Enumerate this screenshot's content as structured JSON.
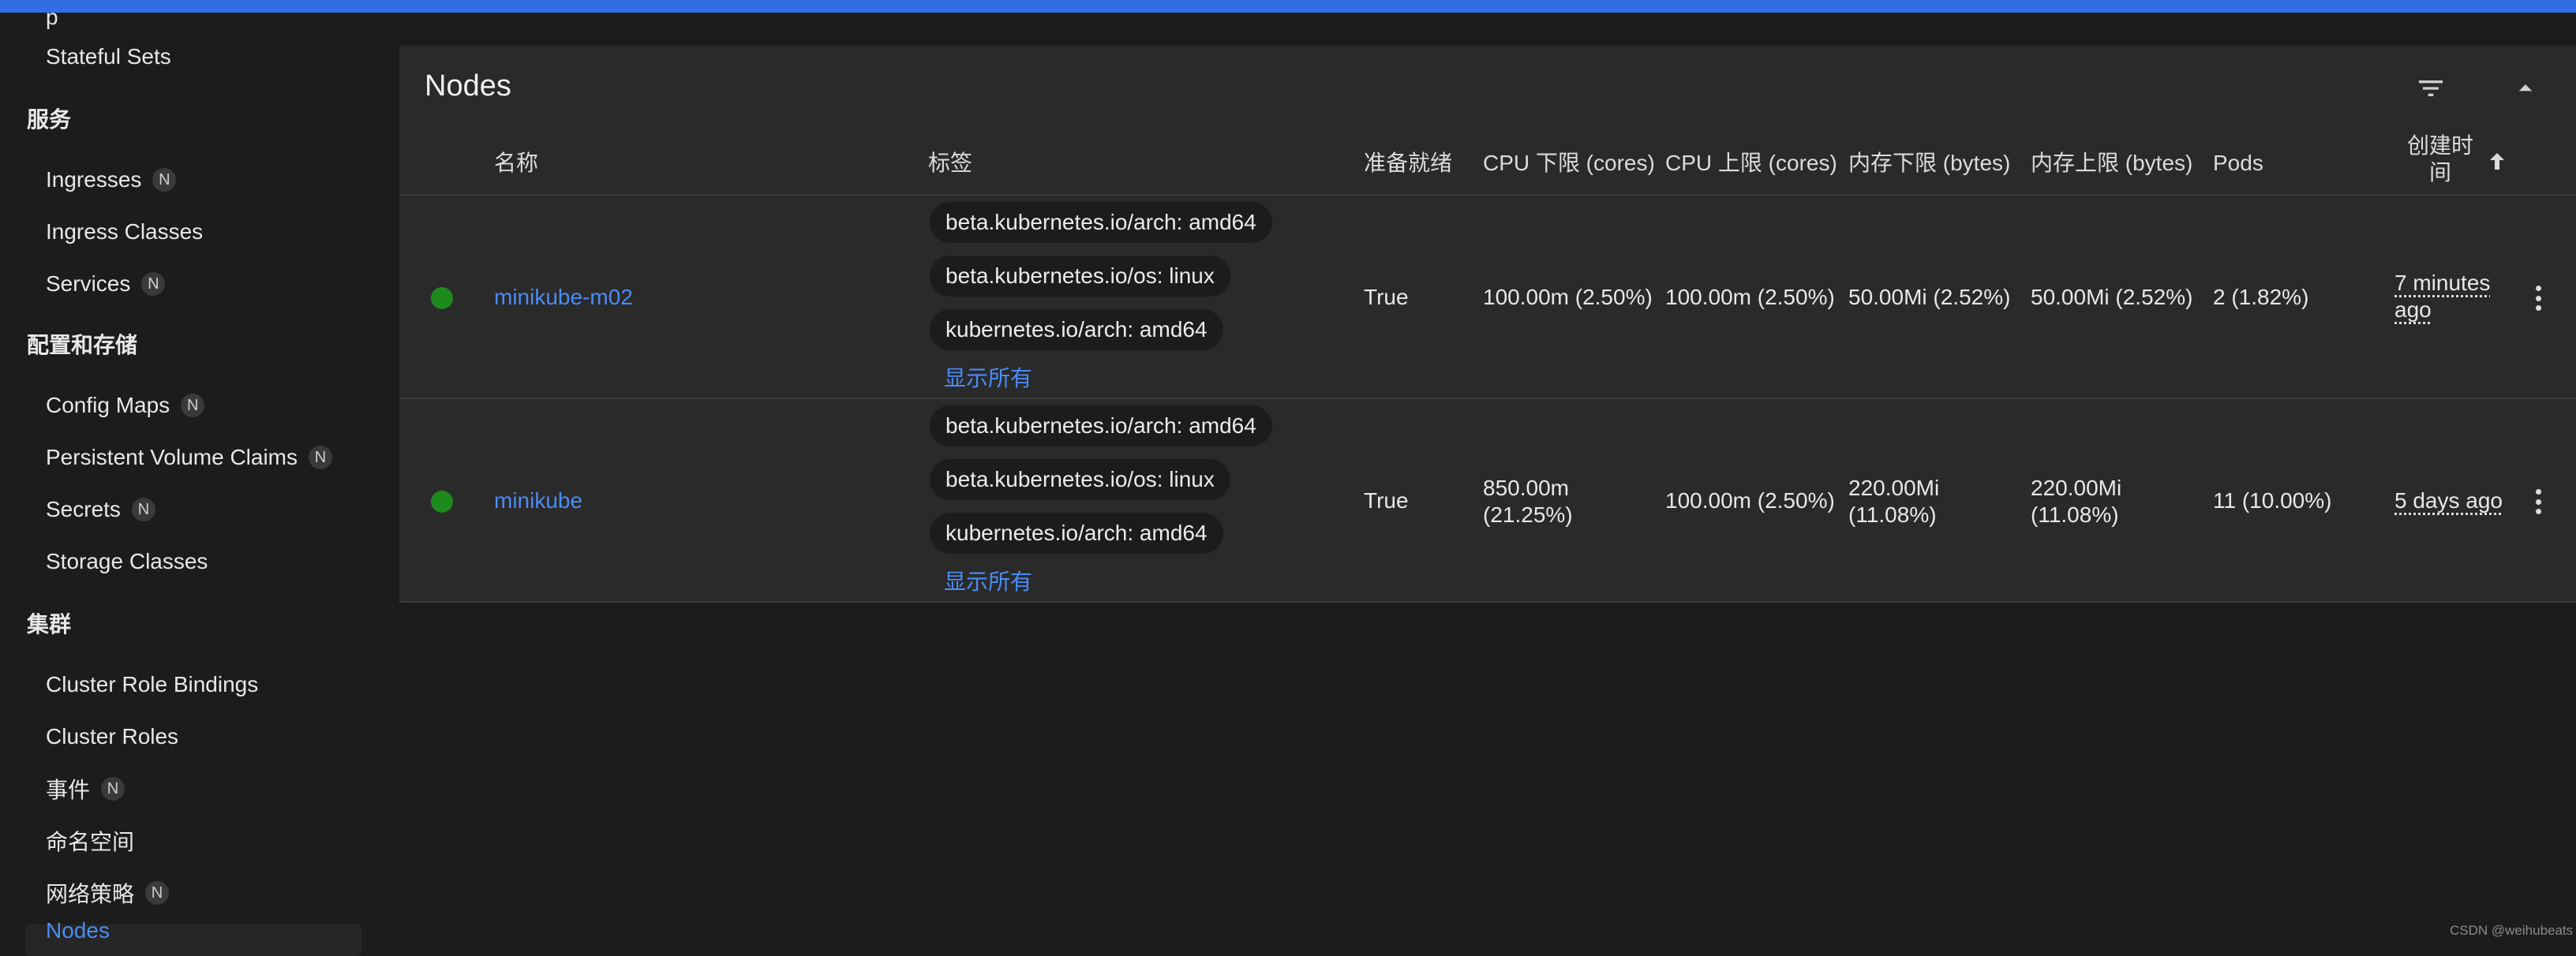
{
  "sidebar": {
    "clipped_item": "p",
    "items": [
      {
        "type": "item",
        "label": "Stateful Sets",
        "badge": ""
      },
      {
        "type": "section",
        "label": "服务"
      },
      {
        "type": "item",
        "label": "Ingresses",
        "badge": "N"
      },
      {
        "type": "item",
        "label": "Ingress Classes",
        "badge": ""
      },
      {
        "type": "item",
        "label": "Services",
        "badge": "N"
      },
      {
        "type": "section",
        "label": "配置和存储"
      },
      {
        "type": "item",
        "label": "Config Maps",
        "badge": "N"
      },
      {
        "type": "item",
        "label": "Persistent Volume Claims",
        "badge": "N"
      },
      {
        "type": "item",
        "label": "Secrets",
        "badge": "N"
      },
      {
        "type": "item",
        "label": "Storage Classes",
        "badge": ""
      },
      {
        "type": "section",
        "label": "集群"
      },
      {
        "type": "item",
        "label": "Cluster Role Bindings",
        "badge": ""
      },
      {
        "type": "item",
        "label": "Cluster Roles",
        "badge": ""
      },
      {
        "type": "item",
        "label": "事件",
        "badge": "N"
      },
      {
        "type": "item",
        "label": "命名空间",
        "badge": ""
      },
      {
        "type": "item",
        "label": "网络策略",
        "badge": "N"
      }
    ],
    "active_item": "Nodes"
  },
  "panel": {
    "title": "Nodes",
    "filter_icon": "filter-list-icon",
    "collapse_icon": "arrow-drop-up-icon"
  },
  "table": {
    "headers": {
      "name": "名称",
      "labels": "标签",
      "ready": "准备就绪",
      "cpu_requests": "CPU 下限 (cores)",
      "cpu_limits": "CPU 上限 (cores)",
      "mem_requests": "内存下限 (bytes)",
      "mem_limits": "内存上限 (bytes)",
      "pods": "Pods",
      "created_line1": "创建时",
      "created_line2": "间",
      "sort_icon": "arrow-upward-icon"
    },
    "rows": [
      {
        "status_color": "#1e8a1e",
        "name": "minikube-m02",
        "labels": [
          "beta.kubernetes.io/arch: amd64",
          "beta.kubernetes.io/os: linux",
          "kubernetes.io/arch: amd64"
        ],
        "show_all": "显示所有",
        "ready": "True",
        "cpu_requests_1": "100.00m (2.50%)",
        "cpu_requests_2": "",
        "cpu_limits": "100.00m (2.50%)",
        "mem_requests_1": "50.00Mi (2.52%)",
        "mem_requests_2": "",
        "mem_limits_1": "50.00Mi (2.52%)",
        "mem_limits_2": "",
        "pods": "2 (1.82%)",
        "created_1": "7 minutes",
        "created_2": "ago"
      },
      {
        "status_color": "#1e8a1e",
        "name": "minikube",
        "labels": [
          "beta.kubernetes.io/arch: amd64",
          "beta.kubernetes.io/os: linux",
          "kubernetes.io/arch: amd64"
        ],
        "show_all": "显示所有",
        "ready": "True",
        "cpu_requests_1": "850.00m",
        "cpu_requests_2": "(21.25%)",
        "cpu_limits": "100.00m (2.50%)",
        "mem_requests_1": "220.00Mi",
        "mem_requests_2": "(11.08%)",
        "mem_limits_1": "220.00Mi",
        "mem_limits_2": "(11.08%)",
        "pods": "11 (10.00%)",
        "created_1": "5 days ago",
        "created_2": ""
      }
    ]
  },
  "watermark": "CSDN @weihubeats",
  "colors": {
    "accent": "#326de6",
    "link": "#4a8cf7",
    "panel": "#2a2a2a",
    "background": "#1c1c1c"
  }
}
